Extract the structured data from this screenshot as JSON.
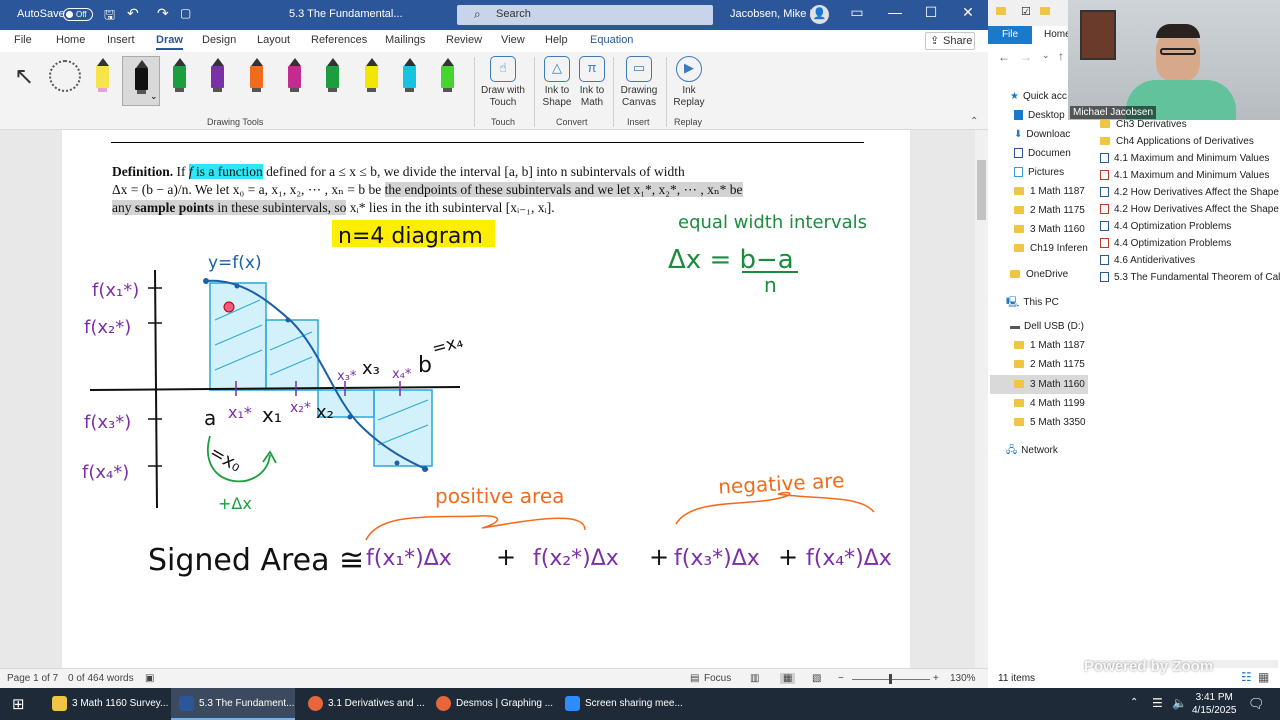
{
  "word": {
    "autosave_label": "AutoSave",
    "autosave_state": "Off",
    "doc_title": "5.3 The Fundamental...",
    "search_placeholder": "Search",
    "user_name": "Jacobsen, Mike E",
    "share_label": "Share",
    "tabs": [
      "File",
      "Home",
      "Insert",
      "Draw",
      "Design",
      "Layout",
      "References",
      "Mailings",
      "Review",
      "View",
      "Help",
      "Equation"
    ],
    "active_tab": "Draw",
    "ribbon": {
      "drawing_tools_label": "Drawing Tools",
      "touch_label": "Touch",
      "convert_label": "Convert",
      "insert_label": "Insert",
      "replay_label": "Replay",
      "draw_with_touch": [
        "Draw with",
        "Touch"
      ],
      "ink_to_shape": [
        "Ink to",
        "Shape"
      ],
      "ink_to_math": [
        "Ink to",
        "Math"
      ],
      "drawing_canvas": [
        "Drawing",
        "Canvas"
      ],
      "ink_replay": [
        "Ink",
        "Replay"
      ]
    },
    "pens": [
      {
        "color": "#f7e34b"
      },
      {
        "color": "#111111"
      },
      {
        "color": "#1b9e3e"
      },
      {
        "color": "#7b2fa8"
      },
      {
        "color": "#f26b1d"
      },
      {
        "color": "#c22c8f"
      },
      {
        "color": "#1b9e3e"
      },
      {
        "color": "#f2e600"
      },
      {
        "color": "#17c3e0"
      },
      {
        "color": "#44d62c"
      }
    ],
    "status": {
      "page": "Page 1 of 7",
      "words": "0 of 464 words",
      "focus": "Focus",
      "zoom": "130%"
    }
  },
  "document": {
    "definition_bold": "Definition.",
    "definition_line1_a": "If ",
    "definition_f": "f",
    "definition_hl": " is a function",
    "definition_line1_b": " defined for a ≤ x ≤ b, we divide the interval [a, b] into n subintervals of width",
    "definition_line2_a": "Δx = (b − a)/n.  We let x₀ = a, x₁, x₂, ⋯ , xₙ = b be ",
    "definition_line2_gray": "the endpoints of these subintervals and we let x₁*, x₂*, ⋯ , xₙ* be",
    "definition_line3_gray_a": "any ",
    "definition_line3_bold": "sample points",
    "definition_line3_gray_b": " in these subintervals, so",
    "definition_line3_c": " xᵢ* lies in the ith subinterval [xᵢ₋₁, xᵢ]."
  },
  "ink": {
    "diagram_label": "n=4  diagram",
    "equal_width": "equal width intervals",
    "dx_formula_top": "Δx = b−a",
    "dx_formula_bottom": "n",
    "y_label": "y=f(x)",
    "fx1": "f(x₁*)",
    "fx2": "f(x₂*)",
    "fx3": "f(x₃*)",
    "fx4": "f(x₄*)",
    "a": "a",
    "x0": "=x₀",
    "x1": "x₁",
    "x1s": "x₁*",
    "x2": "x₂",
    "x2s": "x₂*",
    "x3": "x₃",
    "x3s": "x₃*",
    "x4s": "x₄*",
    "b": "b",
    "bx4": "=x₄",
    "plus_dx": "+Δx",
    "positive_area": "positive area",
    "negative_area": "negative are",
    "signed_area": "Signed Area ≅",
    "term1": "f(x₁*)Δx",
    "plus1": "+",
    "term2": "f(x₂*)Δx",
    "plus2": "+",
    "term3": "f(x₃*)Δx",
    "plus3": "+",
    "term4": "f(x₄*)Δx"
  },
  "explorer": {
    "file_tab": "File",
    "home_tab": "Home",
    "nav": [
      "Quick acc",
      "Desktop",
      "Downloac",
      "Documen",
      "Pictures",
      "1 Math 1187",
      "2 Math 1175",
      "3 Math 1160",
      "Ch19 Inferen",
      "OneDrive",
      "This PC",
      "Dell USB (D:)",
      "1 Math 1187",
      "2 Math 1175",
      "3 Math 1160",
      "4 Math 1199",
      "5 Math 3350",
      "Network"
    ],
    "files": [
      "Ch3 Derivatives",
      "Ch4 Applications of Derivatives",
      "4.1 Maximum and Minimum Values",
      "4.1 Maximum and Minimum Values",
      "4.2 How Derivatives Affect the Shape o",
      "4.2 How Derivatives Affect the Shape o",
      "4.4 Optimization Problems",
      "4.4 Optimization Problems",
      "4.6 Antiderivatives",
      "5.3 The Fundamental Theorem of Calc"
    ],
    "item_count": "11 items",
    "webcam_name": "Michael Jacobsen",
    "zoom_watermark": "Powered by Zoom"
  },
  "taskbar": {
    "items": [
      "3 Math 1160 Survey...",
      "5.3 The Fundament...",
      "3.1 Derivatives and ...",
      "Desmos | Graphing ...",
      "Screen sharing mee..."
    ],
    "time": "3:41 PM",
    "date": "4/15/2025"
  }
}
